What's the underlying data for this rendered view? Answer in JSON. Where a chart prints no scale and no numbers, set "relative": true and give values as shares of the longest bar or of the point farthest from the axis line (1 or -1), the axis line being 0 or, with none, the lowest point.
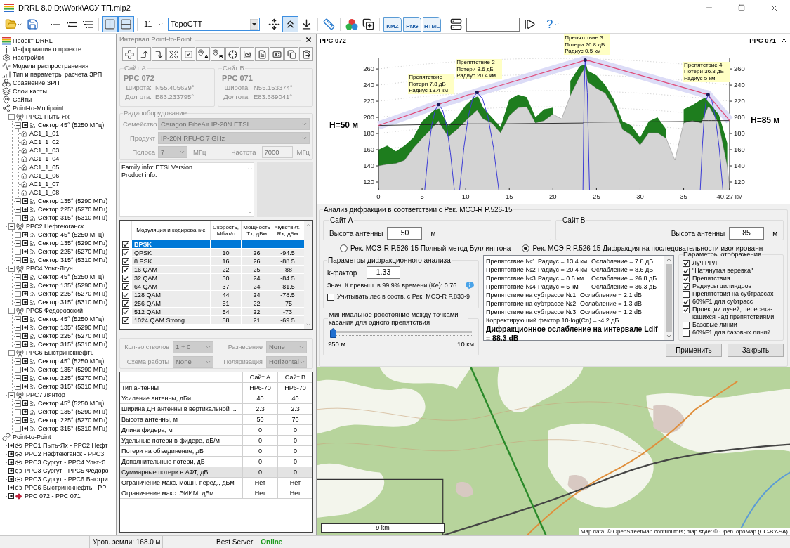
{
  "window": {
    "title": "DRRL 8.0 D:\\Work\\АСУ ТП.mlp2"
  },
  "toolbar": [
    {
      "kind": "open"
    },
    {
      "kind": "save"
    },
    {
      "kind": "separator"
    },
    {
      "kind": "tree-1"
    },
    {
      "kind": "tree-2"
    },
    {
      "kind": "tree-3"
    },
    {
      "kind": "separator"
    },
    {
      "kind": "layout-columns",
      "pressed": true
    },
    {
      "kind": "layout-rows",
      "pressed": true
    },
    {
      "kind": "separator"
    },
    {
      "kind": "dropdown",
      "value": "11"
    },
    {
      "kind": "combo",
      "value": "TopoCTT"
    },
    {
      "kind": "separator"
    },
    {
      "kind": "profile-arrows",
      "pressed": false
    },
    {
      "kind": "profile",
      "pressed": true
    },
    {
      "kind": "download",
      "pressed": false
    },
    {
      "kind": "separator"
    },
    {
      "kind": "ruler"
    },
    {
      "kind": "separator"
    },
    {
      "kind": "colors"
    },
    {
      "kind": "copy-add"
    },
    {
      "kind": "separator"
    },
    {
      "kind": "export",
      "label": "KMZ"
    },
    {
      "kind": "export",
      "label": "PNG"
    },
    {
      "kind": "export",
      "label": "HTML"
    },
    {
      "kind": "separator"
    },
    {
      "kind": "servers"
    },
    {
      "kind": "field"
    },
    {
      "kind": "play"
    },
    {
      "kind": "separator"
    },
    {
      "kind": "help",
      "label": "?"
    }
  ],
  "tree": [
    {
      "kind": "project",
      "label": "Проект DRRL"
    },
    {
      "kind": "info",
      "label": "Информация о проекте"
    },
    {
      "kind": "settings",
      "label": "Настройки"
    },
    {
      "kind": "models",
      "label": "Модели распространения"
    },
    {
      "kind": "calc",
      "label": "Тип и параметры расчета ЗРП"
    },
    {
      "kind": "compare",
      "label": "Сравнение ЗРП"
    },
    {
      "kind": "layers",
      "label": "Слои карты"
    },
    {
      "kind": "sites",
      "label": "Сайты"
    },
    {
      "kind": "p2mp",
      "label": "Point-to-Multipoint",
      "children": [
        {
          "kind": "station",
          "label": "РРС1 Пыть-Ях",
          "expanded": true,
          "children": [
            {
              "kind": "sector",
              "label": "Сектор 45° (5250 МГц)",
              "expanded": true,
              "children": [
                {
                  "kind": "subscriber",
                  "label": "АС1_1_01"
                },
                {
                  "kind": "subscriber",
                  "label": "АС1_1_02"
                },
                {
                  "kind": "subscriber",
                  "label": "АС1_1_03"
                },
                {
                  "kind": "subscriber",
                  "label": "АС1_1_04"
                },
                {
                  "kind": "subscriber",
                  "label": "АС1_1_05"
                },
                {
                  "kind": "subscriber",
                  "label": "АС1_1_06"
                },
                {
                  "kind": "subscriber",
                  "label": "АС1_1_07"
                },
                {
                  "kind": "subscriber",
                  "label": "АС1_1_08"
                }
              ]
            },
            {
              "kind": "sector",
              "label": "Сектор 135° (5290 МГц)",
              "expanded": false
            },
            {
              "kind": "sector",
              "label": "Сектор 225° (5270 МГц)",
              "expanded": false
            },
            {
              "kind": "sector",
              "label": "Сектор 315° (5310 МГц)",
              "expanded": false
            }
          ]
        },
        {
          "kind": "station",
          "label": "РРС2 Нефтеюганск",
          "expanded": true,
          "children": [
            {
              "kind": "sector",
              "label": "Сектор 45° (5250 МГц)",
              "expanded": false
            },
            {
              "kind": "sector",
              "label": "Сектор 135° (5290 МГц)",
              "expanded": false
            },
            {
              "kind": "sector",
              "label": "Сектор 225° (5270 МГц)",
              "expanded": false
            },
            {
              "kind": "sector",
              "label": "Сектор 315° (5310 МГц)",
              "expanded": false
            }
          ]
        },
        {
          "kind": "station",
          "label": "РРС4 Ульт-Ягун",
          "expanded": true,
          "children": [
            {
              "kind": "sector",
              "label": "Сектор 45° (5250 МГц)",
              "expanded": false
            },
            {
              "kind": "sector",
              "label": "Сектор 135° (5290 МГц)",
              "expanded": false
            },
            {
              "kind": "sector",
              "label": "Сектор 225° (5270 МГц)",
              "expanded": false
            },
            {
              "kind": "sector",
              "label": "Сектор 315° (5310 МГц)",
              "expanded": false
            }
          ]
        },
        {
          "kind": "station",
          "label": "РРС5 Федоровский",
          "expanded": true,
          "children": [
            {
              "kind": "sector",
              "label": "Сектор 45° (5250 МГц)",
              "expanded": false
            },
            {
              "kind": "sector",
              "label": "Сектор 135° (5290 МГц)",
              "expanded": false
            },
            {
              "kind": "sector",
              "label": "Сектор 225° (5270 МГц)",
              "expanded": false
            },
            {
              "kind": "sector",
              "label": "Сектор 315° (5310 МГц)",
              "expanded": false
            }
          ]
        },
        {
          "kind": "station",
          "label": "РРС6 Быстринскнефть",
          "expanded": true,
          "children": [
            {
              "kind": "sector",
              "label": "Сектор 45° (5250 МГц)",
              "expanded": false
            },
            {
              "kind": "sector",
              "label": "Сектор 135° (5290 МГц)",
              "expanded": false
            },
            {
              "kind": "sector",
              "label": "Сектор 225° (5270 МГц)",
              "expanded": false
            },
            {
              "kind": "sector",
              "label": "Сектор 315° (5310 МГц)",
              "expanded": false
            }
          ]
        },
        {
          "kind": "station",
          "label": "РРС7 Лянтор",
          "expanded": true,
          "children": [
            {
              "kind": "sector",
              "label": "Сектор 45° (5250 МГц)",
              "expanded": false
            },
            {
              "kind": "sector",
              "label": "Сектор 135° (5290 МГц)",
              "expanded": false
            },
            {
              "kind": "sector",
              "label": "Сектор 225° (5270 МГц)",
              "expanded": false
            },
            {
              "kind": "sector",
              "label": "Сектор 315° (5310 МГц)",
              "expanded": false
            }
          ]
        }
      ]
    },
    {
      "kind": "p2p",
      "label": "Point-to-Point",
      "children": [
        {
          "kind": "link",
          "label": "РРС1 Пыть-Ях - РРС2 Нефт"
        },
        {
          "kind": "link",
          "label": "РРС2 Нефтеюганск - РРС3"
        },
        {
          "kind": "link",
          "label": "РРС3 Сургут - РРС4 Ульт-Я"
        },
        {
          "kind": "link",
          "label": "РРС3 Сургут - РРС5 Федоро"
        },
        {
          "kind": "link",
          "label": "РРС3 Сургут - РРС6 Быстри"
        },
        {
          "kind": "link",
          "label": "РРС6 Быстринскнефть - РР"
        },
        {
          "kind": "active-link",
          "label": "РРС 072 - РРС 071"
        }
      ]
    }
  ],
  "interval_panel": {
    "title": "Интервал Point-to-Point",
    "tools": [
      {
        "kind": "add"
      },
      {
        "kind": "up"
      },
      {
        "kind": "down"
      },
      {
        "kind": "delete"
      },
      {
        "kind": "check"
      },
      {
        "kind": "pin",
        "label": "A"
      },
      {
        "kind": "pin",
        "label": "B"
      },
      {
        "kind": "target"
      },
      {
        "kind": "profile"
      },
      {
        "kind": "document"
      },
      {
        "kind": "card"
      },
      {
        "kind": "copy"
      },
      {
        "kind": "paste"
      }
    ],
    "sites": [
      {
        "title": "Сайт А",
        "name": "РРС 072",
        "lat_label": "Широта:",
        "lat": "N55.405629°",
        "lon_label": "Долгота:",
        "lon": "E83.233795°",
        "disabled": true
      },
      {
        "title": "Сайт В",
        "name": "РРС 071",
        "lat_label": "Широта:",
        "lat": "N55.153374°",
        "lon_label": "Долгота:",
        "lon": "E83.689041°",
        "disabled": true
      }
    ],
    "radio": {
      "title": "Радиооборудование",
      "disabled": true,
      "family_label": "Семейство",
      "family": "Ceragon FibeAir IP-20N ETSI",
      "product_label": "Продукт",
      "product": "IP-20N RFU-C 7 GHz",
      "band_label": "Полоса",
      "band": "7",
      "band_unit": "МГц",
      "freq_label": "Частота",
      "freq": "7000",
      "freq_unit": "МГц"
    },
    "info_lines": [
      "Family info: ETSI Version",
      "Product info:"
    ],
    "modulation": {
      "columns": [
        "Модуляция и кодирование",
        "Скорость, Мбит/с",
        "Мощность Tx, дБм",
        "Чувствит. Rx, дБм"
      ],
      "rows": [
        {
          "checked": true,
          "selected": true,
          "cells": [
            "BPSK"
          ]
        },
        {
          "checked": true,
          "selected": false,
          "cells": [
            "QPSK",
            "10",
            "26",
            "-94.5"
          ]
        },
        {
          "checked": true,
          "selected": false,
          "cells": [
            "8 PSK",
            "16",
            "26",
            "-88.5"
          ]
        },
        {
          "checked": true,
          "selected": false,
          "cells": [
            "16 QAM",
            "22",
            "25",
            "-88"
          ]
        },
        {
          "checked": true,
          "selected": false,
          "cells": [
            "32 QAM",
            "30",
            "24",
            "-84.5"
          ]
        },
        {
          "checked": true,
          "selected": false,
          "cells": [
            "64 QAM",
            "37",
            "24",
            "-81.5"
          ]
        },
        {
          "checked": true,
          "selected": false,
          "cells": [
            "128 QAM",
            "44",
            "24",
            "-78.5"
          ]
        },
        {
          "checked": true,
          "selected": false,
          "cells": [
            "256 QAM",
            "51",
            "22",
            "-75"
          ]
        },
        {
          "checked": true,
          "selected": false,
          "cells": [
            "512 QAM",
            "54",
            "22",
            "-73"
          ]
        },
        {
          "checked": true,
          "selected": false,
          "cells": [
            "1024 QAM Strong",
            "58",
            "21",
            "-69.5"
          ]
        }
      ]
    },
    "settings": {
      "disabled": true,
      "fields": [
        {
          "label": "Кол-во стволов",
          "value": "1 + 0"
        },
        {
          "label": "Разнесение",
          "value": "None"
        },
        {
          "label": "Схема работы",
          "value": "None"
        },
        {
          "label": "Поляризация",
          "value": "Horizontal"
        }
      ]
    },
    "antenna": {
      "columns": [
        "",
        "Сайт А",
        "Сайт В"
      ],
      "rows": [
        {
          "readonly": false,
          "cells": [
            "Тип антенны",
            "HP6-70",
            "HP6-70"
          ]
        },
        {
          "readonly": false,
          "cells": [
            "Усиление антенны, дБи",
            "40",
            "40"
          ]
        },
        {
          "readonly": false,
          "cells": [
            "Ширина ДН антенны в вертикальной ...",
            "2.3",
            "2.3"
          ]
        },
        {
          "readonly": false,
          "cells": [
            "Высота антенны, м",
            "50",
            "70"
          ]
        },
        {
          "readonly": false,
          "cells": [
            "Длина фидера, м",
            "0",
            "0"
          ]
        },
        {
          "readonly": false,
          "cells": [
            "Удельные потери в фидере, дБ/м",
            "0",
            "0"
          ]
        },
        {
          "readonly": false,
          "cells": [
            "Потери на объединение, дБ",
            "0",
            "0"
          ]
        },
        {
          "readonly": false,
          "cells": [
            "Дополнительные потери, дБ",
            "0",
            "0"
          ]
        },
        {
          "readonly": true,
          "cells": [
            "Суммарные потери в АФТ, дБ",
            "0",
            "0"
          ]
        },
        {
          "readonly": false,
          "cells": [
            "Ограничение макс. мощн. перед., дБм",
            "Нет",
            "Нет"
          ]
        },
        {
          "readonly": false,
          "cells": [
            "Ограничение макс. ЭИИМ, дБм",
            "Нет",
            "Нет"
          ]
        }
      ]
    }
  },
  "profile": {
    "left_site": "РРС 072",
    "right_site": "РРС 071",
    "right_axis_ticks": [
      "260",
      "240",
      "220",
      "200",
      "180",
      "160",
      "140",
      "120"
    ],
    "chart_data": {
      "type": "area",
      "x": [
        0,
        1,
        2,
        3,
        4,
        5,
        6,
        6.9,
        7,
        8,
        9,
        10,
        11,
        11.3,
        12,
        13,
        14,
        15,
        16,
        17,
        18,
        19,
        20,
        21,
        22,
        23,
        23.7,
        24,
        25,
        26,
        27,
        28,
        29,
        30,
        31,
        32,
        33,
        34,
        35,
        36,
        37,
        37.8,
        38,
        39,
        40,
        40.27
      ],
      "series": [
        {
          "color": "#d4d4d4",
          "values": [
            140,
            142,
            143,
            147,
            162,
            174,
            185,
            196,
            193,
            176,
            185,
            196,
            206,
            209,
            198,
            193,
            181,
            202,
            212,
            213,
            193,
            196,
            204,
            198,
            227,
            249,
            262,
            244,
            236,
            230,
            212,
            185,
            178,
            166,
            181,
            181,
            174,
            147,
            193,
            196,
            193,
            213,
            212,
            193,
            140,
            113
          ]
        },
        {
          "color": "#1e7d1e",
          "values": [
            160,
            165,
            158,
            165,
            175,
            195,
            205,
            214,
            210,
            190,
            200,
            215,
            225,
            229,
            212,
            200,
            188,
            222,
            228,
            225,
            200,
            210,
            212,
            null,
            245,
            262,
            270,
            258,
            252,
            240,
            222,
            195,
            190,
            175,
            195,
            200,
            185,
            null,
            210,
            215,
            222,
            226,
            225,
            205,
            168,
            null
          ]
        }
      ],
      "xlim": [
        0,
        40.27
      ],
      "ylim": [
        110,
        274
      ],
      "xticks": [
        0,
        5,
        10,
        15,
        20,
        25,
        30,
        35,
        {
          "value": 40.27,
          "label": "40.27 км"
        }
      ],
      "yticks": [
        120,
        140,
        160,
        180,
        200,
        220,
        240,
        260
      ]
    },
    "ray_chart": {
      "chart_data": {
        "type": "line",
        "relative": true,
        "xlim": [
          0,
          40.27
        ],
        "ylim": [
          110,
          274
        ],
        "x": [
          0,
          5.3,
          5.7,
          6.1,
          6.5,
          6.9,
          7.35,
          7.8,
          8.25,
          8.7,
          9.3,
          9.8,
          10.3,
          10.8,
          11.3,
          11.93,
          12.55,
          13.18,
          13.8,
          23.45,
          23.58,
          23.7,
          23.95,
          24.2,
          36.9,
          37.13,
          37.35,
          37.58,
          37.8,
          38.23,
          38.65,
          39.08,
          39.5,
          40.27
        ],
        "series": [
          {
            "color": "#dcdcf7",
            "values": [
              190,
              210,
              212,
              213,
              215,
              216,
              218,
              219,
              221,
              222,
              224,
              226,
              228,
              229,
              231,
              233,
              235,
              237,
              239,
              270,
              271,
              271,
              270,
              270,
              231,
              230,
              229,
              229,
              228,
              222,
              217,
              211,
              206,
              196
            ]
          },
          {
            "color": "#222222",
            "values": [
              190,
              191,
              191,
              191,
              191,
              191,
              191,
              191,
              191,
              191,
              191,
              191,
              192,
              192,
              192,
              192,
              192,
              192,
              192,
              193,
              194,
              194,
              194,
              194,
              195,
              196,
              196,
              196,
              196,
              196,
              196,
              196,
              196,
              196
            ]
          },
          {
            "color": "#e04a78",
            "values": [
              190,
              210,
              212,
              213,
              215,
              216,
              218,
              219,
              221,
              222,
              224,
              226,
              228,
              229,
              231,
              233,
              235,
              237,
              239,
              270,
              271,
              271,
              270,
              270,
              231,
              230,
              229,
              229,
              228,
              222,
              217,
              211,
              206,
              196
            ]
          },
          {
            "color": "#3b3bd6",
            "values": [
              null,
              110,
              156,
              190,
              209,
              216,
              209,
              190,
              156,
              110,
              null,
              null,
              null,
              null,
              null,
              null,
              null,
              null,
              null,
              null,
              null,
              null,
              null,
              null,
              null,
              null,
              null,
              null,
              null,
              null,
              null,
              null,
              null,
              null
            ]
          },
          {
            "color": "#3b3bd6",
            "values": [
              null,
              null,
              null,
              null,
              null,
              null,
              null,
              null,
              null,
              null,
              110,
              163,
              201,
              223,
              231,
              223,
              201,
              163,
              110,
              null,
              null,
              null,
              null,
              null,
              null,
              null,
              null,
              null,
              null,
              null,
              null,
              null,
              null,
              null
            ]
          },
          {
            "color": "#3b3bd6",
            "values": [
              null,
              null,
              null,
              null,
              null,
              null,
              null,
              null,
              null,
              null,
              null,
              null,
              null,
              null,
              null,
              null,
              null,
              null,
              null,
              110,
              231,
              271,
              231,
              110,
              null,
              null,
              null,
              null,
              null,
              null,
              null,
              null,
              null,
              null
            ]
          },
          {
            "color": "#3b3bd6",
            "values": [
              null,
              null,
              null,
              null,
              null,
              null,
              null,
              null,
              null,
              null,
              null,
              null,
              null,
              null,
              null,
              null,
              null,
              null,
              null,
              null,
              null,
              null,
              null,
              null,
              110,
              162,
              199,
              221,
              228,
              221,
              199,
              162,
              110,
              null
            ]
          }
        ],
        "annotations": [
          {
            "x": 0,
            "y": 190,
            "text": "H=50 м"
          },
          {
            "x": 6.9,
            "y": 216,
            "text": "Препятствие\nПотери 7.8 дБ\nРадиус 13.4 км"
          },
          {
            "x": 11.3,
            "y": 231,
            "text": "Препятствие 2\nПотери 8.6 дБ\nРадиус 20.4 км"
          },
          {
            "x": 23.7,
            "y": 271,
            "text": "Препятствие 3\nПотери 26.8 дБ\nРадиус 0.5 км"
          },
          {
            "x": 37.8,
            "y": 228,
            "text": "Препятствие 4\nПотери 36.3 дБ\nРадиус 5 км"
          },
          {
            "x": 40.27,
            "y": 196,
            "text": "H=85 м"
          }
        ]
      }
    }
  },
  "diffraction": {
    "title": "Анализ дифракции в соответствии с Рек. МСЭ-R P.526-15",
    "sites": [
      {
        "title": "Сайт А",
        "label": "Высота антенны",
        "value": "50",
        "unit": "м"
      },
      {
        "title": "Сайт В",
        "label": "Высота антенны",
        "value": "85",
        "unit": "м"
      }
    ],
    "methods": [
      {
        "label": "Рек. МСЭ-R P.526-15 Полный метод Буллингтона",
        "selected": false
      },
      {
        "label": "Рек. МСЭ-R P.526-15 Дифракция на последовательности изолированн",
        "selected": true
      }
    ],
    "params": {
      "title": "Параметры дифракционного анализа",
      "k_label": "k-фактор",
      "k_value": "1.33",
      "ke_text": "Знач. К превыш. в 99.9% времени (Ke): 0.76",
      "forest": {
        "label": "Учитывать лес в соотв. с Рек. МСЭ-R P.833-9",
        "checked": false
      }
    },
    "min_distance": {
      "title": "Минимальное расстояние между точками касания для одного препятствия",
      "level": 0,
      "min": "250 м",
      "max": "10 км"
    },
    "results": [
      {
        "kind": "obstacle",
        "cells": [
          "Препятствие №1",
          "Радиус = 13.4 км",
          "Ослабление = 7.8 дБ"
        ]
      },
      {
        "kind": "obstacle",
        "cells": [
          "Препятствие №2",
          "Радиус = 20.4 км",
          "Ослабление = 8.6 дБ"
        ]
      },
      {
        "kind": "obstacle",
        "cells": [
          "Препятствие №3",
          "Радиус = 0.5 км",
          "Ослабление = 26.8 дБ"
        ]
      },
      {
        "kind": "obstacle",
        "cells": [
          "Препятствие №4",
          "Радиус = 5 км",
          "Ослабление = 36.3 дБ"
        ]
      },
      {
        "kind": "subpath",
        "cells": [
          "Препятствие на субтрассе №1",
          "Ослабление = 2.1 dB"
        ]
      },
      {
        "kind": "subpath",
        "cells": [
          "Препятствие на субтрассе №2",
          "Ослабление = 1.3 dB"
        ]
      },
      {
        "kind": "subpath",
        "cells": [
          "Препятствие на субтрассе №3",
          "Ослабление = 1.2 dB"
        ]
      },
      {
        "kind": "note",
        "cells": [
          "Корректирующий фактор 10·log(Cn) = -4.2 дБ"
        ]
      },
      {
        "kind": "total",
        "cells": [
          "Дифракционное ослабление на интервале Ldif = 88.3 dB"
        ]
      }
    ],
    "display": {
      "title": "Параметры отображения",
      "options": [
        {
          "label": "Луч РРЛ",
          "checked": true
        },
        {
          "label": "\"Натянутая веревка\"",
          "checked": true
        },
        {
          "label": "Препятствия",
          "checked": true
        },
        {
          "label": "Радиусы цилиндров",
          "checked": true
        },
        {
          "label": "Препятствия на субтрассах",
          "checked": false
        },
        {
          "label": "60%F1 для субтрасс",
          "checked": true
        },
        {
          "label": "Проекции лучей, пересека-ющихся над препятствиями",
          "checked": true
        },
        {
          "label": "Базовые линии",
          "checked": false
        },
        {
          "label": "60%F1 для базовых линий",
          "checked": false
        }
      ]
    },
    "buttons": [
      "Применить",
      "Закрыть"
    ]
  },
  "map": {
    "scale": "9 km",
    "attribution": "Map data: © OpenStreetMap contributors; map style: © OpenTopoMap (CC-BY-SA)"
  },
  "status_bar": {
    "ground_level": "Уров. земли: 168.0 м",
    "mode": "Best Server",
    "connection": "Online"
  }
}
